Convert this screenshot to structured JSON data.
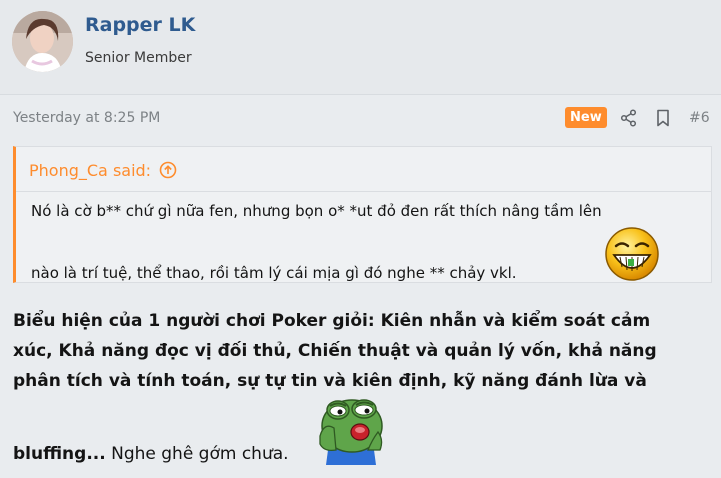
{
  "user": {
    "name": "Rapper LK",
    "title": "Senior Member"
  },
  "post_meta": {
    "timestamp": "Yesterday at 8:25 PM",
    "badge": "New",
    "post_number": "#6",
    "share_icon": "share-icon",
    "bookmark_icon": "bookmark-icon"
  },
  "quote": {
    "author_said": "Phong_Ca said:",
    "line1": "Nó là cờ b** chứ gì nữa fen, nhưng bọn o* *ut đỏ đen rất thích nâng tầm lên",
    "line2": "nào là trí tuệ, thể thao, rồi tâm lý cái mịa gì đó nghe ** chảy vkl."
  },
  "body": {
    "line1": "Biểu hiện của 1 người chơi Poker giỏi: Kiên nhẫn và kiểm soát cảm",
    "line2": "xúc, Khả năng đọc vị đối thủ, Chiến thuật và quản lý vốn, khả năng",
    "line3": "phân tích và tính toán, sự tự tin và kiên định, kỹ năng đánh lừa và",
    "last_bold": "bluffing...",
    "last_normal": " Nghe ghê gớm chưa."
  },
  "colors": {
    "accent_orange": "#fe8c2d",
    "username_blue": "#2f5b8f",
    "background": "#e9ecef"
  }
}
